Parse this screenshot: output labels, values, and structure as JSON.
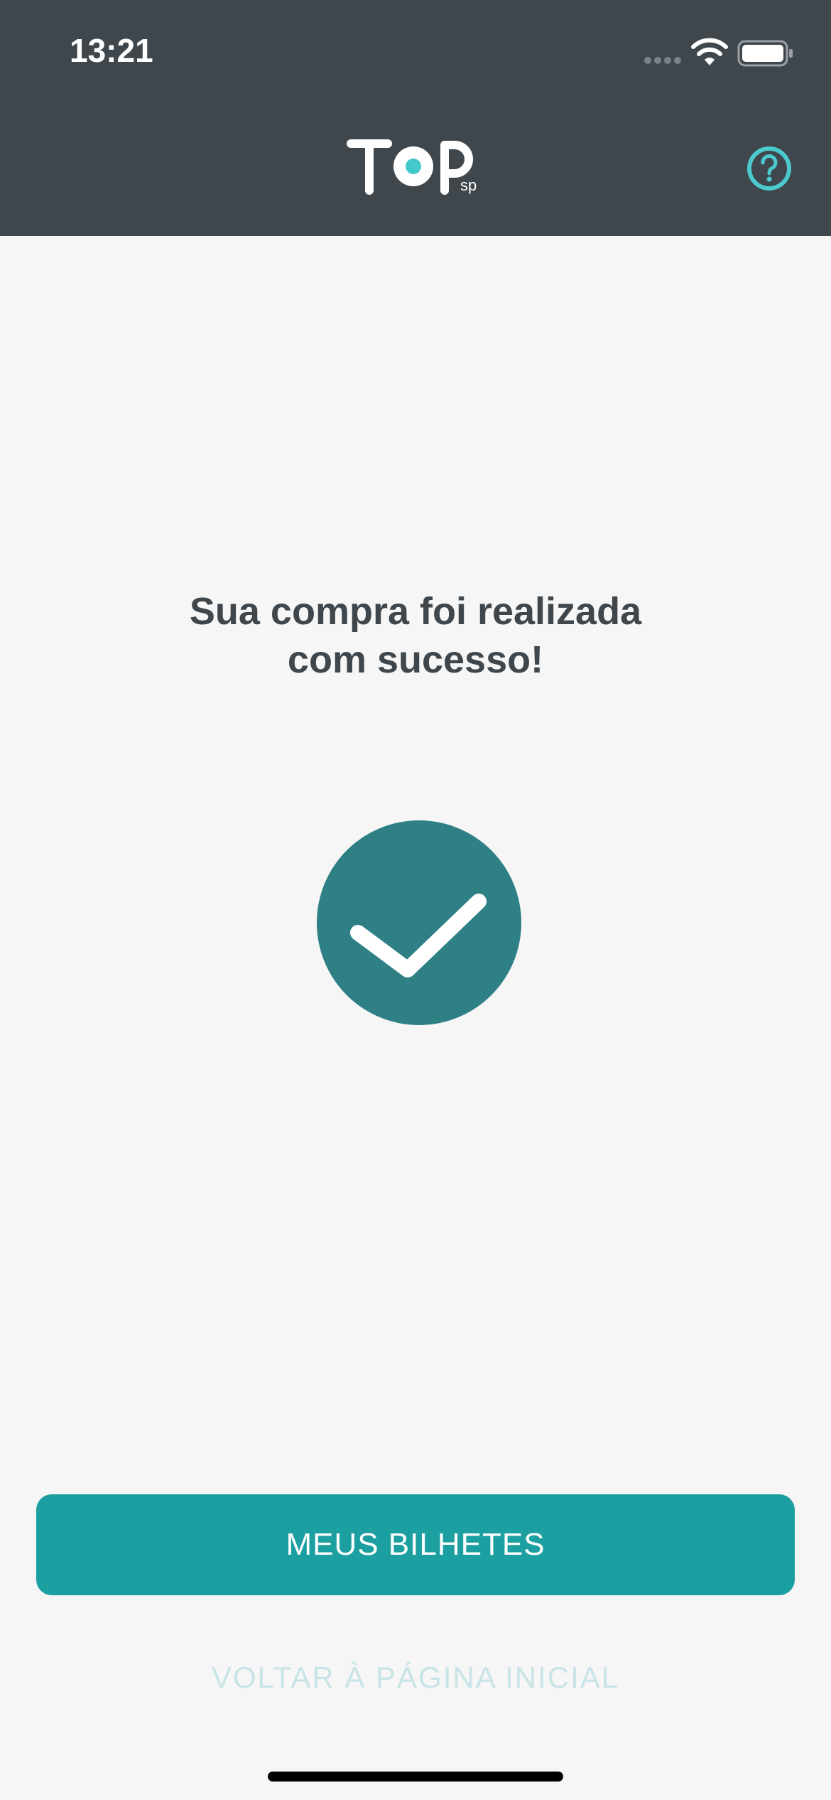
{
  "status_bar": {
    "time": "13:21"
  },
  "header": {
    "logo_text": "TOP",
    "logo_suffix": "sp",
    "help_icon": "question-circle-icon"
  },
  "main": {
    "title_line1": "Sua compra foi realizada",
    "title_line2": "com sucesso!",
    "success_icon": "checkmark-circle-icon"
  },
  "actions": {
    "primary_label": "MEUS BILHETES",
    "secondary_label": "VOLTAR À PÁGINA INICIAL"
  },
  "colors": {
    "header_bg": "#3f474d",
    "accent": "#1c9fa1",
    "success": "#2e8085",
    "help_icon": "#4bc9cc",
    "page_bg": "#f6f6f6"
  }
}
